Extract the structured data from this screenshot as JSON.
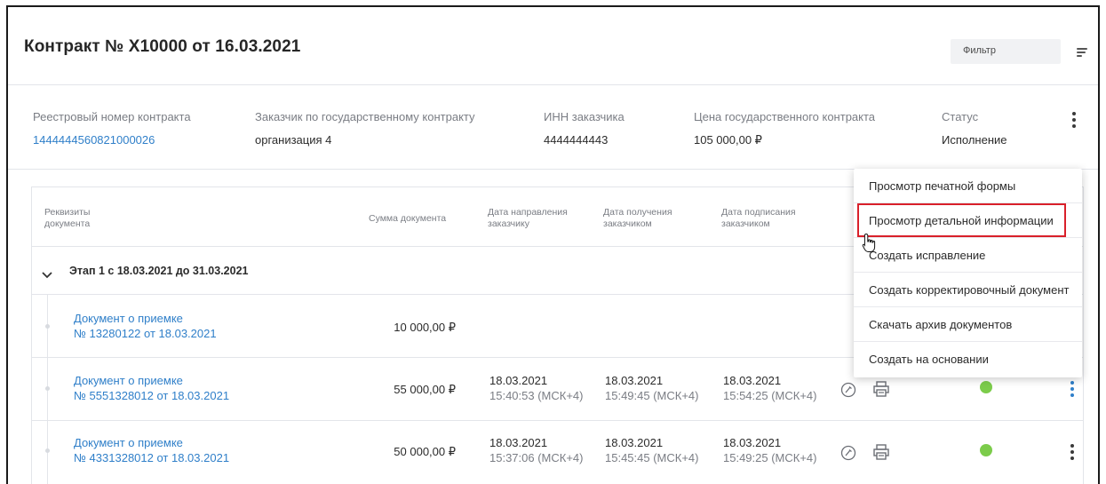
{
  "header": {
    "title": "Контракт № Х10000 от 16.03.2021",
    "filter_label": "Фильтр"
  },
  "info": {
    "registry_label": "Реестровый номер контракта",
    "registry_value": "1444444560821000026",
    "customer_label": "Заказчик по государственному контракту",
    "customer_value": "организация 4",
    "inn_label": "ИНН заказчика",
    "inn_value": "4444444443",
    "price_label": "Цена государственного контракта",
    "price_value": "105 000,00 ₽",
    "status_label": "Статус",
    "status_value": "Исполнение"
  },
  "table": {
    "headers": {
      "doc": [
        "Реквизиты",
        "документа"
      ],
      "amount": "Сумма документа",
      "sent": [
        "Дата направления",
        "заказчику"
      ],
      "received": [
        "Дата получения",
        "заказчиком"
      ],
      "signed": [
        "Дата подписания",
        "заказчиком"
      ]
    },
    "stage": "Этап 1 с 18.03.2021 до 31.03.2021",
    "rows": [
      {
        "title": "Документ о приемке",
        "number": "№ 13280122 от 18.03.2021",
        "amount": "10 000,00 ₽"
      },
      {
        "title": "Документ о приемке",
        "number": "№ 5551328012 от 18.03.2021",
        "amount": "55 000,00 ₽",
        "sent_date": "18.03.2021",
        "sent_time": "15:40:53 (МСК+4)",
        "received_date": "18.03.2021",
        "received_time": "15:49:45 (МСК+4)",
        "signed_date": "18.03.2021",
        "signed_time": "15:54:25 (МСК+4)"
      },
      {
        "title": "Документ о приемке",
        "number": "№ 4331328012 от 18.03.2021",
        "amount": "50 000,00 ₽",
        "sent_date": "18.03.2021",
        "sent_time": "15:37:06 (МСК+4)",
        "received_date": "18.03.2021",
        "received_time": "15:45:45 (МСК+4)",
        "signed_date": "18.03.2021",
        "signed_time": "15:49:25 (МСК+4)"
      }
    ]
  },
  "menu": {
    "items": [
      "Просмотр печатной формы",
      "Просмотр детальной информации",
      "Создать исправление",
      "Создать корректировочный документ",
      "Скачать архив документов",
      "Создать на основании"
    ]
  },
  "colors": {
    "link": "#2f7fc9",
    "status_ok": "#7ccc4b",
    "highlight": "#d9202a"
  },
  "icons": [
    "filter-icon",
    "kebab-menu-icon",
    "chevron-down-icon",
    "signature-icon",
    "print-icon",
    "status-dot-icon",
    "pointer-cursor-icon"
  ]
}
